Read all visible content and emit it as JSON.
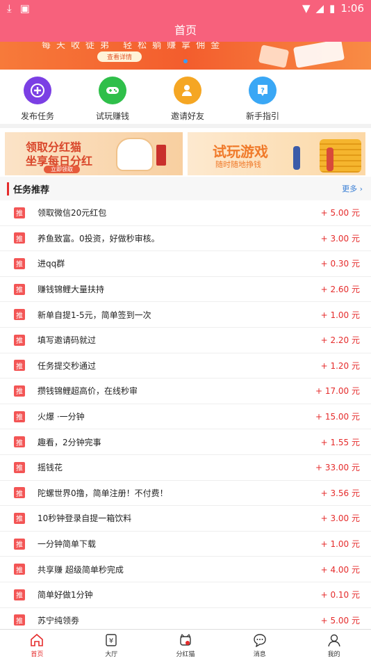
{
  "status_bar": {
    "time": "1:06"
  },
  "header": {
    "title": "首页"
  },
  "banner": {
    "text": "每天收徒弟 轻松躺赚拿佣金",
    "button": "查看详情"
  },
  "quick_actions": [
    {
      "label": "发布任务",
      "icon": "plus-icon",
      "color": "#7b3fe4"
    },
    {
      "label": "试玩赚钱",
      "icon": "gamepad-icon",
      "color": "#2fbf4a"
    },
    {
      "label": "邀请好友",
      "icon": "add-user-icon",
      "color": "#f5a623"
    },
    {
      "label": "新手指引",
      "icon": "help-icon",
      "color": "#3aa7f5"
    }
  ],
  "promos": [
    {
      "line1": "领取分红猫",
      "line2": "坐享每日分红",
      "button": "立即领取"
    },
    {
      "line1": "试玩游戏",
      "line2": "随时随地挣钱"
    }
  ],
  "section": {
    "title": "任务推荐",
    "more": "更多"
  },
  "tag_label": "推",
  "tasks": [
    {
      "title": "领取微信20元红包",
      "amount": "+ 5.00 元"
    },
    {
      "title": "养鱼致富。0投资，好做秒审核。",
      "amount": "+ 3.00 元"
    },
    {
      "title": "进qq群",
      "amount": "+ 0.30 元"
    },
    {
      "title": "赚钱锦鲤大量扶持",
      "amount": "+ 2.60 元"
    },
    {
      "title": "新单自提1-5元，简单签到一次",
      "amount": "+ 1.00 元"
    },
    {
      "title": "填写邀请码就过",
      "amount": "+ 2.20 元"
    },
    {
      "title": "任务提交秒通过",
      "amount": "+ 1.20 元"
    },
    {
      "title": "攒钱锦鲤超高价，在线秒审",
      "amount": "+ 17.00 元"
    },
    {
      "title": "火爆 ·一分钟",
      "amount": "+ 15.00 元"
    },
    {
      "title": "趣看，2分钟完事",
      "amount": "+ 1.55 元"
    },
    {
      "title": "摇钱花",
      "amount": "+ 33.00 元"
    },
    {
      "title": "陀螺世界0撸，简单注册！不付费！",
      "amount": "+ 3.56 元"
    },
    {
      "title": "10秒钟登录自提一箱饮料",
      "amount": "+ 3.00 元"
    },
    {
      "title": "一分钟简单下载",
      "amount": "+ 1.00 元"
    },
    {
      "title": "共享赚 超级简单秒完成",
      "amount": "+ 4.00 元"
    },
    {
      "title": "简单好做1分钟",
      "amount": "+ 0.10 元"
    },
    {
      "title": "苏宁纯领劵",
      "amount": "+ 5.00 元"
    }
  ],
  "tabs": [
    {
      "label": "首页",
      "icon": "home-icon",
      "active": true
    },
    {
      "label": "大厅",
      "icon": "yuan-icon",
      "active": false
    },
    {
      "label": "分红猫",
      "icon": "cat-icon",
      "active": false
    },
    {
      "label": "消息",
      "icon": "message-icon",
      "active": false
    },
    {
      "label": "我的",
      "icon": "profile-icon",
      "active": false
    }
  ]
}
